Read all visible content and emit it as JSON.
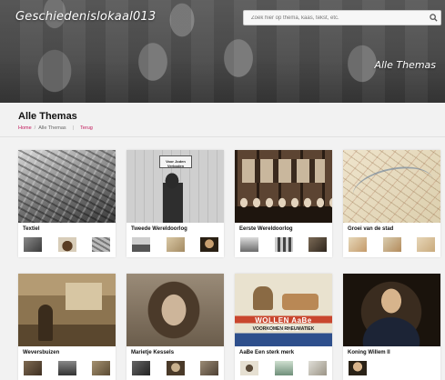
{
  "header": {
    "logo_text": "Geschiedenislokaal013",
    "search_placeholder": "Zoek hier op thema, kaas, tekst, etc.",
    "hero_title": "Alle Themas"
  },
  "page": {
    "title": "Alle Themas",
    "breadcrumb": {
      "home": "Home",
      "separator": "/",
      "current": "Alle Themas",
      "back": "Terug"
    }
  },
  "colors": {
    "link": "#c2185b",
    "title": "#111111",
    "background": "#f2f2f2"
  },
  "cards": [
    {
      "title": "Textiel"
    },
    {
      "title": "Tweede Wereldoorlog",
      "image_text": "Voor Joden Verboden"
    },
    {
      "title": "Eerste Wereldoorlog"
    },
    {
      "title": "Groei van de stad"
    },
    {
      "title": "Weversbuizen"
    },
    {
      "title": "Marietje Kessels"
    },
    {
      "title": "AaBe Een sterk merk",
      "image_text": "WOLLEN AaBe DEKENS",
      "image_subtext": "VOORKOMEN RHEUMATIEK"
    },
    {
      "title": "Koning Willem II"
    }
  ]
}
